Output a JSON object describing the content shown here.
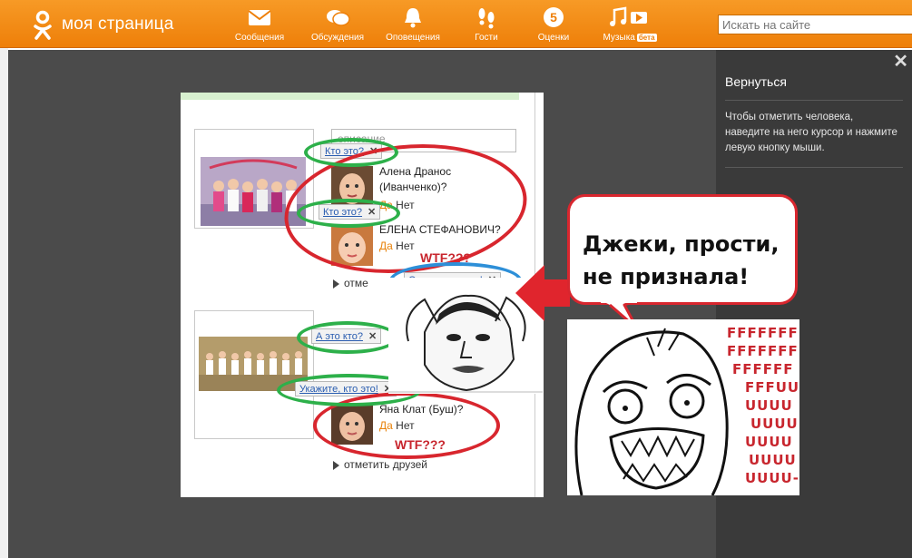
{
  "header": {
    "logo_text": "моя страница",
    "nav": [
      {
        "label": "Сообщения",
        "icon": "envelope-icon"
      },
      {
        "label": "Обсуждения",
        "icon": "chat-bubbles-icon"
      },
      {
        "label": "Оповещения",
        "icon": "bell-icon"
      },
      {
        "label": "Гости",
        "icon": "footprints-icon"
      },
      {
        "label": "Оценки",
        "icon": "rating-five-icon",
        "badge": "5"
      },
      {
        "label": "Музыка",
        "icon": "music-note-icon",
        "tag": "бета"
      }
    ],
    "search_placeholder": "Искать на сайте"
  },
  "panel": {
    "back_link": "Вернуться",
    "hint": "Чтобы отметить человека, наведите на него курсор и нажмите левую кнопку мыши."
  },
  "photo": {
    "description_placeholder": "описание",
    "group1": {
      "tags": [
        "Кто это?",
        "Кто это?"
      ],
      "people": [
        {
          "name": "Алена Дранос (Иванченко)?",
          "yes": "Да",
          "no": "Нет"
        },
        {
          "name": "ЕЛЕНА СТЕФАНОВИЧ?",
          "yes": "Да",
          "no": "Нет"
        }
      ],
      "wtf": "WTF???",
      "mark_link": "отме"
    },
    "friend_tag": "Отметьте друга!",
    "group2": {
      "tags": [
        "А это кто?",
        "Укажите, кто это!"
      ],
      "people": [
        {
          "name": "Яна Клат (Буш)?",
          "yes": "Да",
          "no": "Нет"
        }
      ],
      "wtf": "WTF???",
      "mark_link": "отметить друзей"
    }
  },
  "meme": {
    "bubble_line1": "Джеки, прости,",
    "bubble_line2": "не признала!",
    "rage_lines": [
      "FFFFFFF",
      "FFFFFFF",
      "FFFFFF",
      "FFFUU",
      "UUUU",
      "UUUU",
      "UUUU",
      "UUUU",
      "UUUU-"
    ]
  },
  "colors": {
    "header_orange": "#ee7f09",
    "overlay_gray": "#4b4b4b",
    "ring_red": "#d8262e",
    "ring_green": "#2db04a",
    "ring_blue": "#2d8fd8"
  }
}
